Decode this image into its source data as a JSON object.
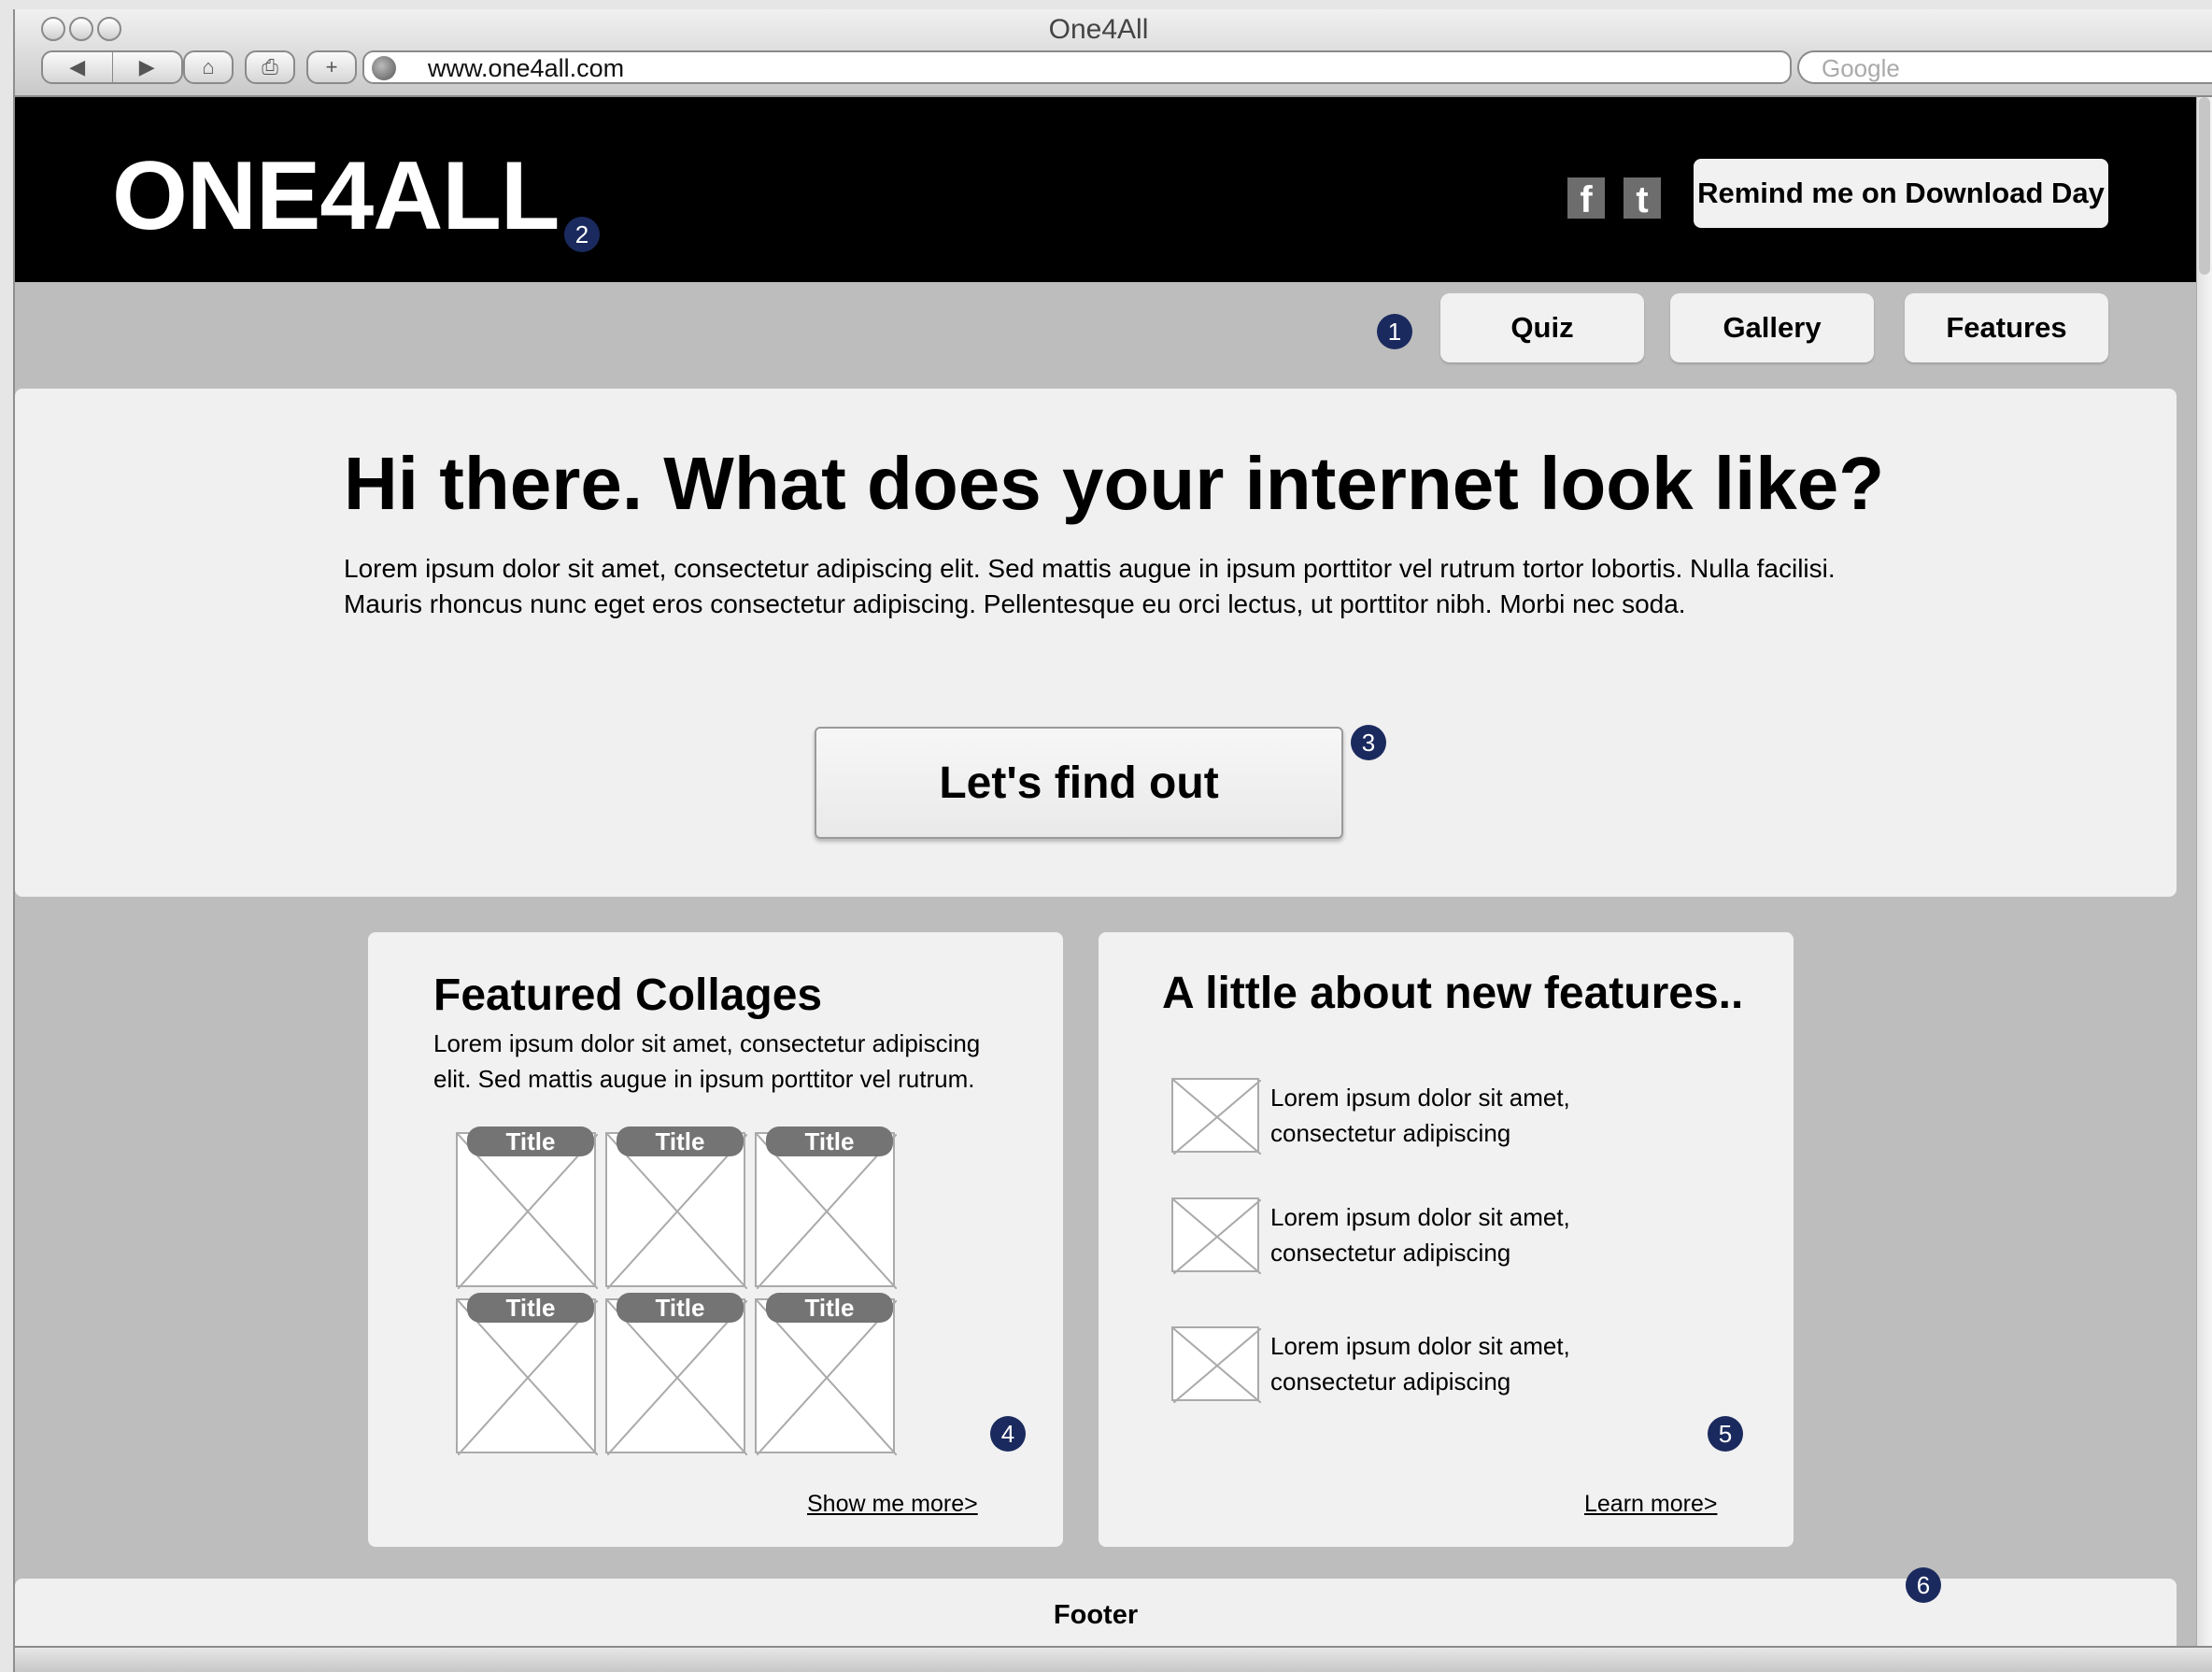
{
  "browser": {
    "window_title": "One4All",
    "url": "www.one4all.com",
    "search_placeholder": "Google",
    "nav_glyphs": {
      "back": "◀",
      "forward": "▶",
      "home": "⌂",
      "print": "⎙",
      "add": "+"
    }
  },
  "header": {
    "logo": "ONE4ALL",
    "facebook_glyph": "f",
    "twitter_glyph": "t",
    "remind_label": "Remind me on Download Day"
  },
  "nav": {
    "tabs": [
      {
        "label": "Quiz"
      },
      {
        "label": "Gallery"
      },
      {
        "label": "Features"
      }
    ]
  },
  "hero": {
    "heading": "Hi there. What does your internet look like?",
    "text": "Lorem ipsum dolor sit amet, consectetur adipiscing elit. Sed mattis augue in ipsum porttitor vel rutrum tortor lobortis. Nulla facilisi. Mauris rhoncus nunc eget eros consectetur adipiscing. Pellentesque eu orci lectus, ut porttitor nibh. Morbi nec soda.",
    "cta_label": "Let's find out"
  },
  "collages": {
    "title": "Featured Collages",
    "text": "Lorem ipsum dolor sit amet, consectetur adipiscing elit. Sed mattis augue in ipsum porttitor vel rutrum.",
    "items": [
      {
        "title": "Title"
      },
      {
        "title": "Title"
      },
      {
        "title": "Title"
      },
      {
        "title": "Title"
      },
      {
        "title": "Title"
      },
      {
        "title": "Title"
      }
    ],
    "more_link": "Show me more>"
  },
  "features": {
    "title": "A little about new features..",
    "items": [
      {
        "line1": "Lorem ipsum dolor sit amet,",
        "line2": "consectetur adipiscing"
      },
      {
        "line1": "Lorem ipsum dolor sit amet,",
        "line2": "consectetur adipiscing"
      },
      {
        "line1": "Lorem ipsum dolor sit amet,",
        "line2": "consectetur adipiscing"
      }
    ],
    "more_link": "Learn more>"
  },
  "footer": {
    "label": "Footer"
  },
  "annotations": {
    "nav": "1",
    "logo": "2",
    "cta": "3",
    "collages": "4",
    "features": "5",
    "footer": "6"
  },
  "colors": {
    "header_bg": "#000000",
    "page_bg": "#bdbdbd",
    "panel_bg": "#f0f0f0",
    "marker_bg": "#1b2a5e",
    "title_pill": "#747474"
  }
}
